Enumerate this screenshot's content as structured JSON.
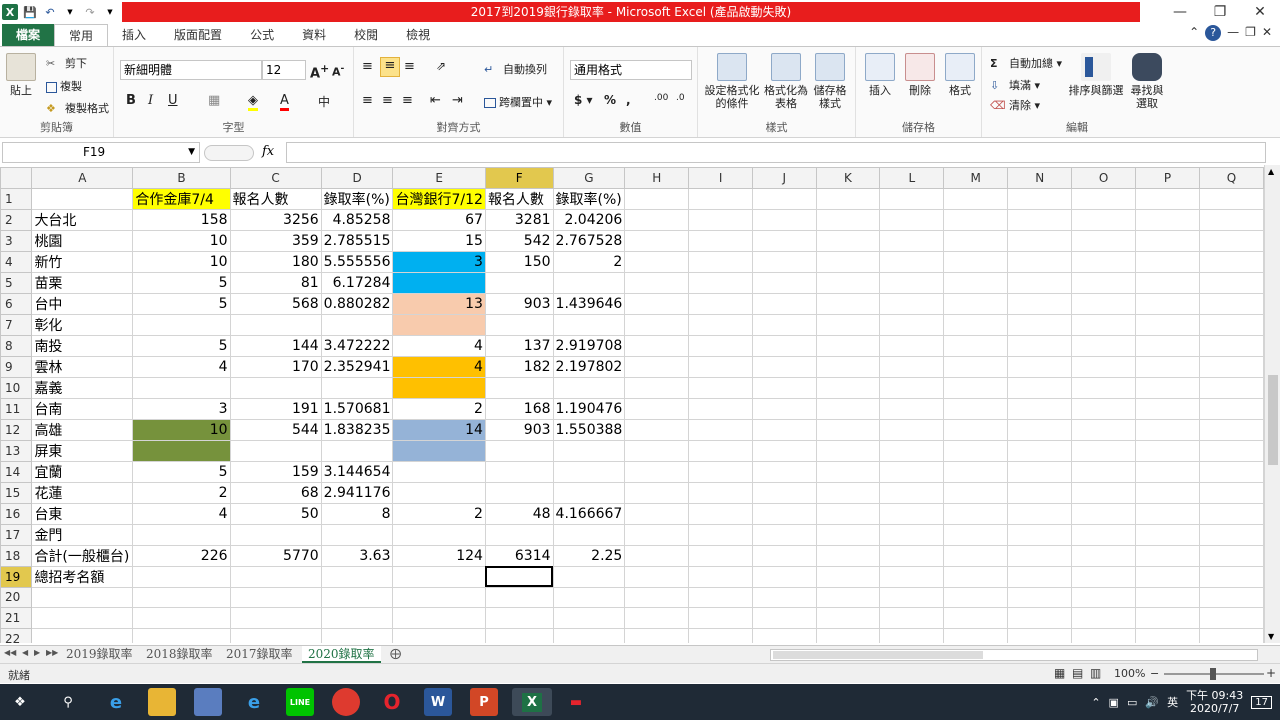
{
  "window": {
    "title": "2017到2019銀行錄取率 - Microsoft Excel (產品啟動失敗)",
    "qat_icons": [
      "excel-logo-icon",
      "save-icon",
      "undo-icon",
      "redo-icon",
      "customize-icon"
    ]
  },
  "tabs": [
    "檔案",
    "常用",
    "插入",
    "版面配置",
    "公式",
    "資料",
    "校閱",
    "檢視"
  ],
  "ribbon": {
    "clipboard": {
      "paste": "貼上",
      "cut": "剪下",
      "copy": "複製",
      "format_painter": "複製格式",
      "label": "剪貼簿"
    },
    "font": {
      "name": "新細明體",
      "size": "12",
      "label": "字型"
    },
    "alignment": {
      "wrap": "自動換列",
      "merge": "跨欄置中",
      "label": "對齊方式"
    },
    "number": {
      "format": "通用格式",
      "label": "數值"
    },
    "styles": {
      "conditional": "設定格式化\n的條件",
      "as_table": "格式化為\n表格",
      "cell_styles": "儲存格\n樣式",
      "label": "樣式"
    },
    "cells": {
      "insert": "插入",
      "delete": "刪除",
      "format": "格式",
      "label": "儲存格"
    },
    "editing": {
      "autosum": "自動加總",
      "fill": "填滿",
      "clear": "清除",
      "sort": "排序與篩選",
      "find": "尋找與\n選取",
      "label": "編輯"
    }
  },
  "formula_bar": {
    "name_box": "F19",
    "fx": "fx",
    "formula": ""
  },
  "columns": [
    "A",
    "B",
    "C",
    "D",
    "E",
    "F",
    "G",
    "H",
    "I",
    "J",
    "K",
    "L",
    "M",
    "N",
    "O",
    "P",
    "Q"
  ],
  "selected_column": "F",
  "selected_row": "19",
  "rows": [
    {
      "n": "1",
      "A": "",
      "B": "合作金庫7/4",
      "C": "報名人數",
      "D": "錄取率(%)",
      "E": "台灣銀行7/12",
      "F": "報名人數",
      "G": "錄取率(%)"
    },
    {
      "n": "2",
      "A": "大台北",
      "B": "158",
      "C": "3256",
      "D": "4.85258",
      "E": "67",
      "F": "3281",
      "G": "2.04206"
    },
    {
      "n": "3",
      "A": "桃園",
      "B": "10",
      "C": "359",
      "D": "2.785515",
      "E": "15",
      "F": "542",
      "G": "2.767528"
    },
    {
      "n": "4",
      "A": "新竹",
      "B": "10",
      "C": "180",
      "D": "5.555556",
      "E": "3",
      "F": "150",
      "G": "2"
    },
    {
      "n": "5",
      "A": "苗栗",
      "B": "5",
      "C": "81",
      "D": "6.17284",
      "E": "",
      "F": "",
      "G": ""
    },
    {
      "n": "6",
      "A": "台中",
      "B": "5",
      "C": "568",
      "D": "0.880282",
      "E": "13",
      "F": "903",
      "G": "1.439646"
    },
    {
      "n": "7",
      "A": "彰化",
      "B": "",
      "C": "",
      "D": "",
      "E": "",
      "F": "",
      "G": ""
    },
    {
      "n": "8",
      "A": "南投",
      "B": "5",
      "C": "144",
      "D": "3.472222",
      "E": "4",
      "F": "137",
      "G": "2.919708"
    },
    {
      "n": "9",
      "A": "雲林",
      "B": "4",
      "C": "170",
      "D": "2.352941",
      "E": "4",
      "F": "182",
      "G": "2.197802"
    },
    {
      "n": "10",
      "A": "嘉義",
      "B": "",
      "C": "",
      "D": "",
      "E": "",
      "F": "",
      "G": ""
    },
    {
      "n": "11",
      "A": "台南",
      "B": "3",
      "C": "191",
      "D": "1.570681",
      "E": "2",
      "F": "168",
      "G": "1.190476"
    },
    {
      "n": "12",
      "A": "高雄",
      "B": "10",
      "C": "544",
      "D": "1.838235",
      "E": "14",
      "F": "903",
      "G": "1.550388"
    },
    {
      "n": "13",
      "A": "屏東",
      "B": "",
      "C": "",
      "D": "",
      "E": "",
      "F": "",
      "G": ""
    },
    {
      "n": "14",
      "A": "宜蘭",
      "B": "5",
      "C": "159",
      "D": "3.144654",
      "E": "",
      "F": "",
      "G": ""
    },
    {
      "n": "15",
      "A": "花蓮",
      "B": "2",
      "C": "68",
      "D": "2.941176",
      "E": "",
      "F": "",
      "G": ""
    },
    {
      "n": "16",
      "A": "台東",
      "B": "4",
      "C": "50",
      "D": "8",
      "E": "2",
      "F": "48",
      "G": "4.166667"
    },
    {
      "n": "17",
      "A": "金門",
      "B": "",
      "C": "",
      "D": "",
      "E": "",
      "F": "",
      "G": ""
    },
    {
      "n": "18",
      "A": "合計(一般櫃台)",
      "B": "226",
      "C": "5770",
      "D": "3.63",
      "E": "124",
      "F": "6314",
      "G": "2.25"
    },
    {
      "n": "19",
      "A": "總招考名額",
      "B": "",
      "C": "",
      "D": "",
      "E": "",
      "F": "",
      "G": ""
    },
    {
      "n": "20",
      "A": "",
      "B": "",
      "C": "",
      "D": "",
      "E": "",
      "F": "",
      "G": ""
    },
    {
      "n": "21",
      "A": "",
      "B": "",
      "C": "",
      "D": "",
      "E": "",
      "F": "",
      "G": ""
    },
    {
      "n": "22",
      "A": "",
      "B": "",
      "C": "",
      "D": "",
      "E": "",
      "F": "",
      "G": ""
    }
  ],
  "fills": {
    "B1": "#ffff00",
    "E1": "#ffff00",
    "E4": "#00b0f0",
    "E5": "#00b0f0",
    "E6": "#f8cbad",
    "E7": "#f8cbad",
    "E9": "#ffc000",
    "E10": "#ffc000",
    "B12": "#76923c",
    "B13": "#76923c",
    "E12": "#95b3d7",
    "E13": "#95b3d7"
  },
  "selected_cell": "F19",
  "sheets": [
    "2019錄取率",
    "2018錄取率",
    "2017錄取率",
    "2020錄取率"
  ],
  "active_sheet": "2020錄取率",
  "status": {
    "ready": "就緒",
    "zoom": "100%"
  },
  "taskbar": {
    "apps": [
      "windows-start-icon",
      "search-icon",
      "edge-icon",
      "file-explorer-icon",
      "store-icon",
      "ie-icon",
      "line-icon",
      "chrome-icon",
      "opera-icon",
      "word-icon",
      "powerpoint-icon",
      "excel-icon",
      "app-icon"
    ],
    "ime": "英",
    "time": "下午 09:43",
    "date": "2020/7/7",
    "notifications": "17"
  }
}
